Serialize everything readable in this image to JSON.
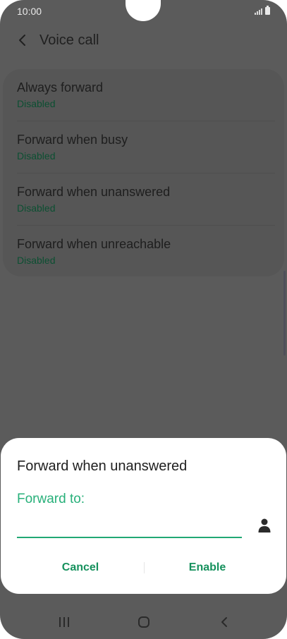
{
  "status_bar": {
    "time": "10:00",
    "icons": [
      "signal-icon",
      "battery-icon"
    ]
  },
  "header": {
    "back_icon": "chevron-left-icon",
    "title": "Voice call"
  },
  "settings": {
    "items": [
      {
        "title": "Always forward",
        "status": "Disabled"
      },
      {
        "title": "Forward when busy",
        "status": "Disabled"
      },
      {
        "title": "Forward when unanswered",
        "status": "Disabled"
      },
      {
        "title": "Forward when unreachable",
        "status": "Disabled"
      }
    ]
  },
  "dialog": {
    "title": "Forward when unanswered",
    "field_label": "Forward to:",
    "field_value": "",
    "contact_icon": "person-icon",
    "cancel_label": "Cancel",
    "enable_label": "Enable"
  },
  "nav_bar": {
    "icons": [
      "recent-apps-icon",
      "home-icon",
      "back-icon"
    ]
  },
  "colors": {
    "accent": "#21a874",
    "status_text": "#0c4f32",
    "overlay_background": "#5b5b5b",
    "dialog_background": "#ffffff"
  }
}
